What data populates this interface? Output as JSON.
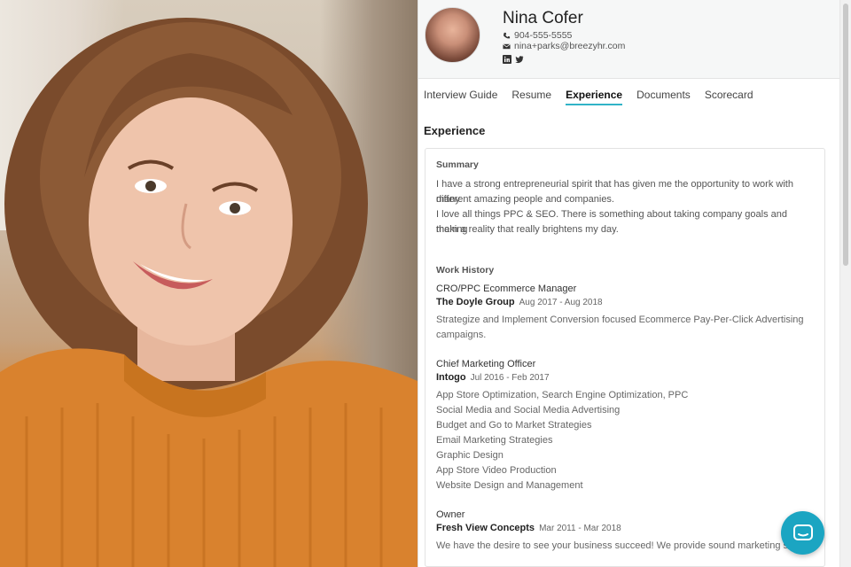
{
  "profile": {
    "name": "Nina Cofer",
    "phone": "904-555-5555",
    "email": "nina+parks@breezyhr.com",
    "social_icons": [
      "linkedin-icon",
      "twitter-icon"
    ]
  },
  "tabs": [
    {
      "label": "Interview Guide",
      "active": false
    },
    {
      "label": "Resume",
      "active": false
    },
    {
      "label": "Experience",
      "active": true
    },
    {
      "label": "Documents",
      "active": false
    },
    {
      "label": "Scorecard",
      "active": false
    }
  ],
  "section_title": "Experience",
  "summary": {
    "label": "Summary",
    "line1": "I have a strong entrepreneurial spirit that has given me the opportunity to work with many",
    "line2": "different amazing people and companies.",
    "line3": "I love all things PPC & SEO. There is something about taking company goals and making",
    "line4": "them a reality that really brightens my day."
  },
  "work_history": {
    "label": "Work History",
    "jobs": [
      {
        "title": "CRO/PPC Ecommerce Manager",
        "company": "The Doyle Group",
        "dates": "Aug 2017 - Aug 2018",
        "lines": [
          "Strategize and Implement Conversion focused Ecommerce Pay-Per-Click Advertising",
          "campaigns."
        ]
      },
      {
        "title": "Chief Marketing Officer",
        "company": "Intogo",
        "dates": "Jul 2016 - Feb 2017",
        "lines": [
          "App Store Optimization, Search Engine Optimization, PPC",
          "Social Media and Social Media Advertising",
          "Budget and Go to Market Strategies",
          "Email Marketing Strategies",
          "Graphic Design",
          "App Store Video Production",
          "Website Design and Management"
        ]
      },
      {
        "title": "Owner",
        "company": "Fresh View Concepts",
        "dates": "Mar 2011 - Mar 2018",
        "lines": [
          "We have the desire to see your business succeed! We provide sound marketing solu"
        ]
      }
    ]
  },
  "colors": {
    "accent": "#31b3c7",
    "chat_button": "#1ba5c2"
  }
}
